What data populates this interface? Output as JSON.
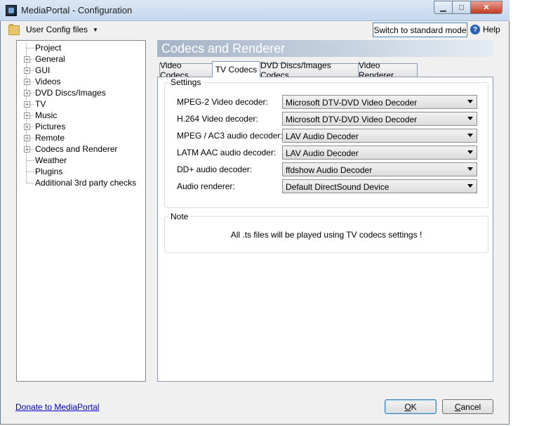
{
  "window": {
    "title": "MediaPortal - Configuration",
    "controls": {
      "minimize": "▁",
      "maximize": "□",
      "close": "✕"
    }
  },
  "toolbar": {
    "user_config_label": "User Config files",
    "dropdown_arrow": "▼",
    "switch_mode_label": "Switch to standard mode",
    "help_label": "Help",
    "help_icon_glyph": "?"
  },
  "tree": {
    "items": [
      {
        "label": "Project",
        "expandable": false
      },
      {
        "label": "General",
        "expandable": true
      },
      {
        "label": "GUI",
        "expandable": true
      },
      {
        "label": "Videos",
        "expandable": true
      },
      {
        "label": "DVD Discs/Images",
        "expandable": true
      },
      {
        "label": "TV",
        "expandable": true
      },
      {
        "label": "Music",
        "expandable": true
      },
      {
        "label": "Pictures",
        "expandable": true
      },
      {
        "label": "Remote",
        "expandable": true
      },
      {
        "label": "Codecs and Renderer",
        "expandable": true
      },
      {
        "label": "Weather",
        "expandable": false
      },
      {
        "label": "Plugins",
        "expandable": false
      },
      {
        "label": "Additional 3rd party checks",
        "expandable": false
      }
    ],
    "expander_glyph": "+"
  },
  "content": {
    "section_title": "Codecs and Renderer",
    "tabs": [
      {
        "label": "Video Codecs",
        "active": false
      },
      {
        "label": "TV Codecs",
        "active": true
      },
      {
        "label": "DVD Discs/Images Codecs",
        "active": false
      },
      {
        "label": "Video Renderer",
        "active": false
      }
    ],
    "settings_legend": "Settings",
    "fields": [
      {
        "label": "MPEG-2 Video decoder:",
        "value": "Microsoft DTV-DVD Video Decoder"
      },
      {
        "label": "H.264 Video decoder:",
        "value": "Microsoft DTV-DVD Video Decoder"
      },
      {
        "label": "MPEG / AC3 audio decoder:",
        "value": "LAV Audio Decoder"
      },
      {
        "label": "LATM AAC audio decoder:",
        "value": "LAV Audio Decoder"
      },
      {
        "label": "DD+ audio decoder:",
        "value": "ffdshow Audio Decoder"
      },
      {
        "label": "Audio renderer:",
        "value": "Default DirectSound Device"
      }
    ],
    "note_legend": "Note",
    "note_text": "All .ts files will be played using TV codecs settings !"
  },
  "footer": {
    "donate_link": "Donate to MediaPortal",
    "ok_label": "OK",
    "cancel_label": "Cancel"
  },
  "colors": {
    "link": "#0000cc",
    "close_button": "#c23a22",
    "section_header": "#a5b3c7",
    "focus_border": "#3c7fb1"
  }
}
